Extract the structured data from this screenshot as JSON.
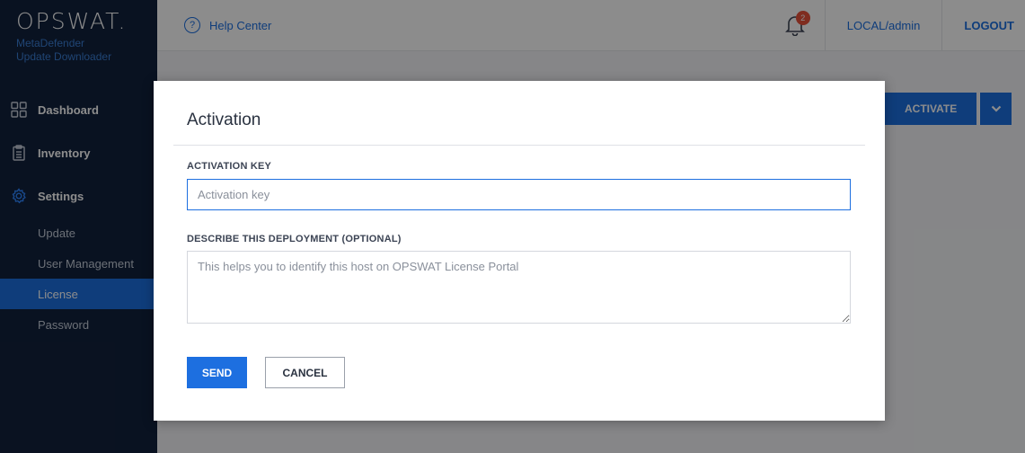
{
  "brand": {
    "logo": "OPSWAT.",
    "product_line1": "MetaDefender",
    "product_line2": "Update Downloader"
  },
  "sidebar": {
    "items": [
      {
        "label": "Dashboard",
        "icon": "dashboard-grid-icon"
      },
      {
        "label": "Inventory",
        "icon": "clipboard-icon"
      },
      {
        "label": "Settings",
        "icon": "gear-icon"
      }
    ],
    "settings_children": [
      {
        "label": "Update",
        "active": false
      },
      {
        "label": "User Management",
        "active": false
      },
      {
        "label": "License",
        "active": true
      },
      {
        "label": "Password",
        "active": false
      }
    ]
  },
  "header": {
    "help_label": "Help Center",
    "notifications_count": "2",
    "user": "LOCAL/admin",
    "logout": "LOGOUT"
  },
  "page": {
    "activate_label": "ACTIVATE"
  },
  "modal": {
    "title": "Activation",
    "key_label": "ACTIVATION KEY",
    "key_placeholder": "Activation key",
    "key_value": "",
    "desc_label": "DESCRIBE THIS DEPLOYMENT (OPTIONAL)",
    "desc_placeholder": "This helps you to identify this host on OPSWAT License Portal",
    "desc_value": "",
    "send_label": "SEND",
    "cancel_label": "CANCEL"
  },
  "colors": {
    "accent": "#1d6fe0",
    "sidebar_bg": "#12213c",
    "badge": "#e8503a"
  }
}
